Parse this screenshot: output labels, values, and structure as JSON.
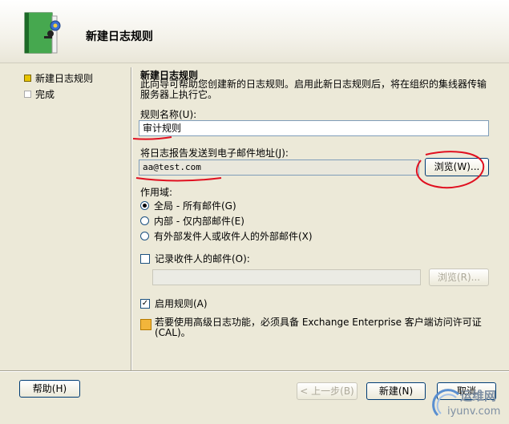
{
  "header": {
    "title": "新建日志规则"
  },
  "nav": {
    "items": [
      {
        "label": "新建日志规则",
        "state": "current"
      },
      {
        "label": "完成",
        "state": "pending"
      }
    ]
  },
  "main": {
    "section_title": "新建日志规则",
    "description": "此向导可帮助您创建新的日志规则。启用此新日志规则后，将在组织的集线器传输服务器上执行它。",
    "rule_name": {
      "label": "规则名称(U):",
      "value": "审计规则"
    },
    "email": {
      "label": "将日志报告发送到电子邮件地址(J):",
      "value": "aa@test.com",
      "browse_label": "浏览(W)..."
    },
    "scope": {
      "label": "作用域:",
      "options": [
        {
          "label": "全局 - 所有邮件(G)",
          "selected": true
        },
        {
          "label": "内部 - 仅内部邮件(E)",
          "selected": false
        },
        {
          "label": "有外部发件人或收件人的外部邮件(X)",
          "selected": false
        }
      ]
    },
    "recipient": {
      "label": "记录收件人的邮件(O):",
      "checked": false,
      "value": "",
      "browse_label": "浏览(R)..."
    },
    "enable": {
      "label": "启用规则(A)",
      "checked": true
    },
    "info": "若要使用高级日志功能，必须具备 Exchange Enterprise 客户端访问许可证(CAL)。"
  },
  "footer": {
    "help": "帮助(H)",
    "back": "< 上一步(B)",
    "new": "新建(N)",
    "cancel": "取消"
  },
  "watermark": {
    "text": "运维网",
    "url": "iyunv.com"
  },
  "colors": {
    "annotation": "#e01020",
    "accent": "#003c74",
    "nav_current": "#e7c400"
  },
  "icons": [
    "wizard-book-icon",
    "info-warning-icon",
    "radio-selected",
    "checkmark"
  ]
}
